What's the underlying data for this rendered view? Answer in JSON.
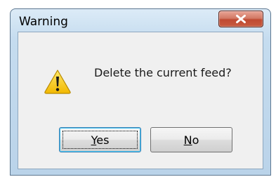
{
  "window": {
    "title": "Warning"
  },
  "dialog": {
    "message": "Delete the current feed?",
    "icon": "warning-icon"
  },
  "buttons": {
    "yes": {
      "accel": "Y",
      "rest": "es"
    },
    "no": {
      "accel": "N",
      "rest": "o"
    }
  },
  "colors": {
    "close_button": "#c75b40",
    "focus_border": "#3c7fb1",
    "warning_triangle": "#f5c400"
  }
}
